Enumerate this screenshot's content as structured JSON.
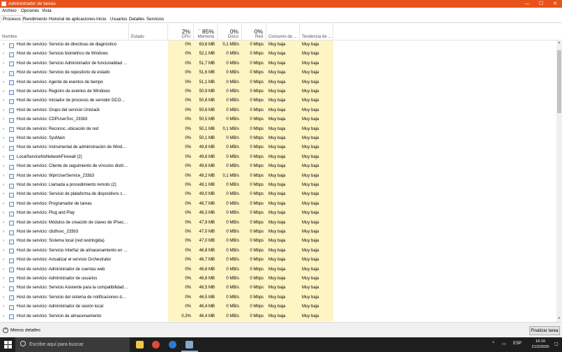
{
  "window": {
    "title": "Administrador de tareas",
    "minimize": "—",
    "maximize": "☐",
    "close": "✕"
  },
  "menu": [
    "Archivo",
    "Opciones",
    "Vista"
  ],
  "tabs": [
    "Procesos",
    "Rendimiento",
    "Historial de aplicaciones",
    "Inicio",
    "Usuarios",
    "Detalles",
    "Servicios"
  ],
  "columns": {
    "nombre": {
      "label": "Nombre"
    },
    "estado": {
      "label": "Estado"
    },
    "cpu": {
      "pct": "2%",
      "label": "CPU"
    },
    "memoria": {
      "pct": "85%",
      "label": "Memoria"
    },
    "disco": {
      "pct": "0%",
      "label": "Disco"
    },
    "red": {
      "pct": "0%",
      "label": "Red"
    },
    "consumo": {
      "label": "Consumo de ..."
    },
    "tendencia": {
      "label": "Tendencia de ..."
    }
  },
  "rows": [
    [
      "Host de servicio: Servicio de directivas de diagnóstico",
      "0%",
      "63,6 MB",
      "0,1 MB/s",
      "0 Mbps",
      "Muy baja",
      "Muy baja"
    ],
    [
      "Host de servicio: Servicio biométrico de Windows",
      "0%",
      "52,1 MB",
      "0 MB/s",
      "0 Mbps",
      "Muy baja",
      "Muy baja"
    ],
    [
      "Host de servicio: Servicio Administrador de funcionalidad de...",
      "0%",
      "51,7 MB",
      "0 MB/s",
      "0 Mbps",
      "Muy baja",
      "Muy baja"
    ],
    [
      "Host de servicio: Servicio de repositorio de estado",
      "0%",
      "51,6 MB",
      "0 MB/s",
      "0 Mbps",
      "Muy baja",
      "Muy baja"
    ],
    [
      "Host de servicio: Agente de eventos de tiempo",
      "0%",
      "51,1 MB",
      "0 MB/s",
      "0 Mbps",
      "Muy baja",
      "Muy baja"
    ],
    [
      "Host de servicio: Registro de eventos de Windows",
      "0%",
      "50,9 MB",
      "0 MB/s",
      "0 Mbps",
      "Muy baja",
      "Muy baja"
    ],
    [
      "Host de servicio: Iniciador de procesos de servidor DCOM (4)",
      "0%",
      "50,8 MB",
      "0 MB/s",
      "0 Mbps",
      "Muy baja",
      "Muy baja"
    ],
    [
      "Host de servicio: Grupo del servicio Unistack",
      "0%",
      "50,6 MB",
      "0 MB/s",
      "0 Mbps",
      "Muy baja",
      "Muy baja"
    ],
    [
      "Host de servicio: CDPUserSvc_233b3",
      "0%",
      "50,5 MB",
      "0 MB/s",
      "0 Mbps",
      "Muy baja",
      "Muy baja"
    ],
    [
      "Host de servicio: Reconoc. ubicación de red",
      "0%",
      "50,1 MB",
      "0,1 MB/s",
      "0 Mbps",
      "Muy baja",
      "Muy baja"
    ],
    [
      "Host de servicio: SysMain",
      "0%",
      "50,1 MB",
      "0 MB/s",
      "0 Mbps",
      "Muy baja",
      "Muy baja"
    ],
    [
      "Host de servicio: Instrumental de administración de Windows",
      "0%",
      "49,8 MB",
      "0 MB/s",
      "0 Mbps",
      "Muy baja",
      "Muy baja"
    ],
    [
      "LocalServiceNoNetworkFirewall (2)",
      "0%",
      "49,6 MB",
      "0 MB/s",
      "0 Mbps",
      "Muy baja",
      "Muy baja"
    ],
    [
      "Host de servicio: Cliente de seguimiento de vínculos distribu...",
      "0%",
      "49,6 MB",
      "0 MB/s",
      "0 Mbps",
      "Muy baja",
      "Muy baja"
    ],
    [
      "Host de servicio: WpnUserService_233b3",
      "0%",
      "49,2 MB",
      "0,1 MB/s",
      "0 Mbps",
      "Muy baja",
      "Muy baja"
    ],
    [
      "Host de servicio: Llamada a procedimiento remoto (2)",
      "0%",
      "49,1 MB",
      "0 MB/s",
      "0 Mbps",
      "Muy baja",
      "Muy baja"
    ],
    [
      "Host de servicio: Servicio de plataforma de dispositivos cone...",
      "0%",
      "49,0 MB",
      "0 MB/s",
      "0 Mbps",
      "Muy baja",
      "Muy baja"
    ],
    [
      "Host de servicio: Programador de tareas",
      "0%",
      "48,7 MB",
      "0 MB/s",
      "0 Mbps",
      "Muy baja",
      "Muy baja"
    ],
    [
      "Host de servicio: Plug and Play",
      "0%",
      "48,3 MB",
      "0 MB/s",
      "0 Mbps",
      "Muy baja",
      "Muy baja"
    ],
    [
      "Host de servicio: Módulos de creación de claves de IPsec par...",
      "0%",
      "47,9 MB",
      "0 MB/s",
      "0 Mbps",
      "Muy baja",
      "Muy baja"
    ],
    [
      "Host de servicio: cbdhsvc_233b3",
      "0%",
      "47,0 MB",
      "0 MB/s",
      "0 Mbps",
      "Muy baja",
      "Muy baja"
    ],
    [
      "Host de servicio: Sistema local (red restringida)",
      "0%",
      "47,0 MB",
      "0 MB/s",
      "0 Mbps",
      "Muy baja",
      "Muy baja"
    ],
    [
      "Host de servicio: Servicio Interfaz de almacenamiento en red",
      "0%",
      "46,8 MB",
      "0 MB/s",
      "0 Mbps",
      "Muy baja",
      "Muy baja"
    ],
    [
      "Host de servicio: Actualizar el servicio Orchestrator",
      "0%",
      "46,7 MB",
      "0 MB/s",
      "0 Mbps",
      "Muy baja",
      "Muy baja"
    ],
    [
      "Host de servicio: Administrador de cuentas web",
      "0%",
      "46,6 MB",
      "0 MB/s",
      "0 Mbps",
      "Muy baja",
      "Muy baja"
    ],
    [
      "Host de servicio: Administrador de usuarios",
      "0%",
      "46,6 MB",
      "0 MB/s",
      "0 Mbps",
      "Muy baja",
      "Muy baja"
    ],
    [
      "Host de servicio: Servicio Asistente para la compatibilidad de...",
      "0%",
      "46,5 MB",
      "0 MB/s",
      "0 Mbps",
      "Muy baja",
      "Muy baja"
    ],
    [
      "Host de servicio: Servicio del sistema de notificaciones de in...",
      "0%",
      "46,5 MB",
      "0 MB/s",
      "0 Mbps",
      "Muy baja",
      "Muy baja"
    ],
    [
      "Host de servicio: Administrador de sesión local",
      "0%",
      "46,4 MB",
      "0 MB/s",
      "0 Mbps",
      "Muy baja",
      "Muy baja"
    ],
    [
      "Host de servicio: Servicio de almacenamiento",
      "0,3%",
      "46,4 MB",
      "0 MB/s",
      "0 Mbps",
      "Muy baja",
      "Muy baja"
    ]
  ],
  "footer": {
    "fewer_details": "Menos detalles",
    "end_task": "Finalizar tarea"
  },
  "taskbar": {
    "search_placeholder": "Escribe aquí para buscar",
    "lang": "ESP",
    "time": "16:10",
    "date": "21/2/2020"
  },
  "colors": {
    "titlebar": "#e8531c",
    "heat_light": "#fff4c4",
    "taskbar": "#1e1e1e",
    "chrome_icon": "#dd4b39",
    "edge_icon": "#2b7bd3"
  }
}
